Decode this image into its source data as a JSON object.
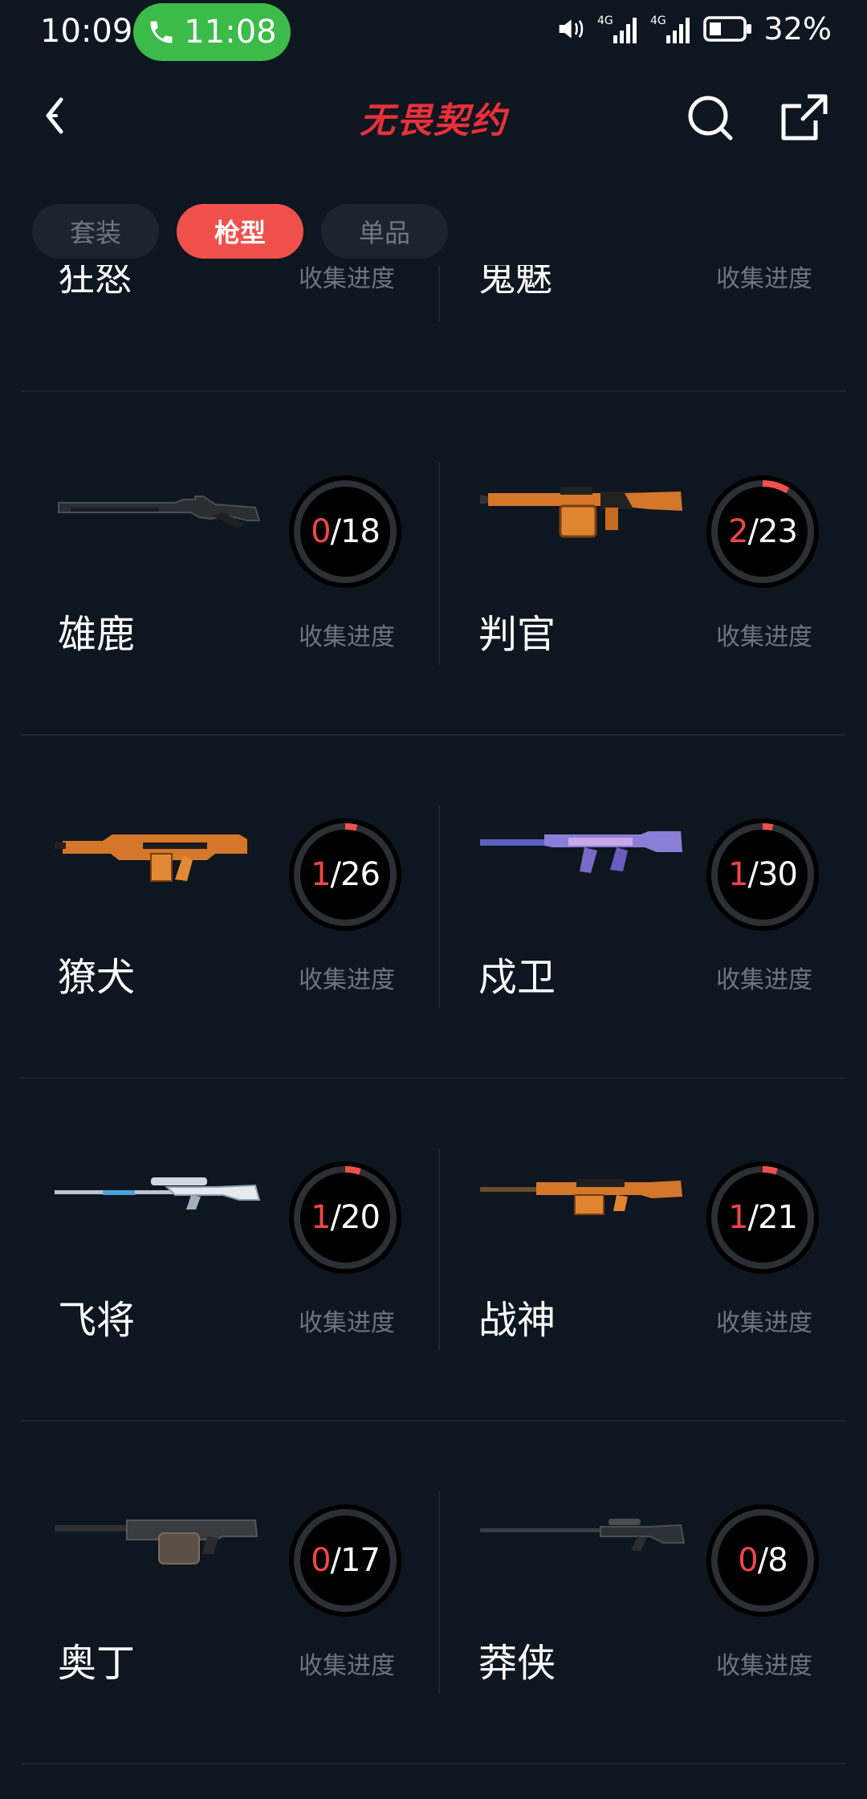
{
  "status": {
    "time": "10:09",
    "call_time": "11:08",
    "battery": "32%"
  },
  "header": {
    "title": "无畏契约"
  },
  "tabs": [
    {
      "label": "套装",
      "active": false
    },
    {
      "label": "枪型",
      "active": true
    },
    {
      "label": "单品",
      "active": false
    }
  ],
  "colors": {
    "accent": "#f0504c",
    "background": "#0e1620"
  },
  "progress_label": "收集进度",
  "partial_row": [
    {
      "name": "狂怒",
      "label": "收集进度"
    },
    {
      "name": "鬼魅",
      "label": "收集进度"
    }
  ],
  "weapons": [
    {
      "name": "雄鹿",
      "collected": 0,
      "total": 18,
      "icon": "bucky-shotgun-icon"
    },
    {
      "name": "判官",
      "collected": 2,
      "total": 23,
      "icon": "judge-shotgun-icon"
    },
    {
      "name": "獠犬",
      "collected": 1,
      "total": 26,
      "icon": "bulldog-rifle-icon"
    },
    {
      "name": "戍卫",
      "collected": 1,
      "total": 30,
      "icon": "guardian-rifle-icon"
    },
    {
      "name": "飞将",
      "collected": 1,
      "total": 20,
      "icon": "marshal-sniper-icon"
    },
    {
      "name": "战神",
      "collected": 1,
      "total": 21,
      "icon": "ares-mg-icon"
    },
    {
      "name": "奥丁",
      "collected": 0,
      "total": 17,
      "icon": "odin-mg-icon"
    },
    {
      "name": "莽侠",
      "collected": 0,
      "total": 8,
      "icon": "outlaw-sniper-icon"
    }
  ]
}
